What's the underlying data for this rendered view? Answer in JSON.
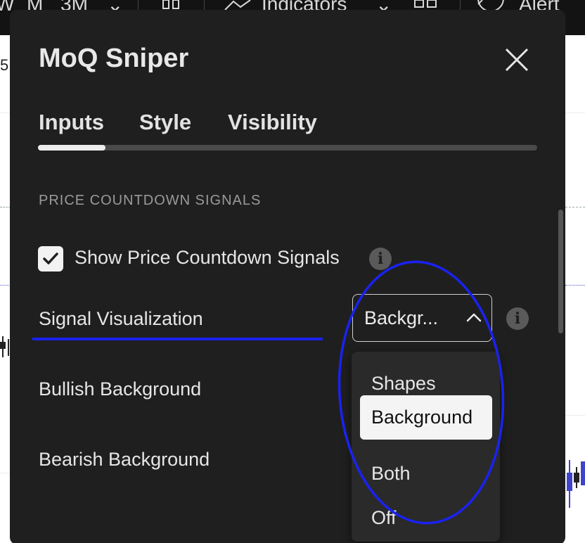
{
  "toolbar": {
    "items": [
      "W",
      "M",
      "3M",
      "⌄",
      "Indicators",
      "⌄",
      "Alert"
    ]
  },
  "chart": {
    "price_label": "5"
  },
  "dialog": {
    "title": "MoQ Sniper",
    "tabs": [
      "Inputs",
      "Style",
      "Visibility"
    ],
    "active_tab": "Inputs",
    "section_header": "PRICE COUNTDOWN SIGNALS",
    "show_signals": {
      "label": "Show Price Countdown Signals",
      "checked": true
    },
    "signal_visualization": {
      "label": "Signal Visualization",
      "value": "Backgr...",
      "options": [
        "Shapes",
        "Background",
        "Both",
        "Off"
      ],
      "selected": "Background"
    },
    "bullish_background": {
      "label": "Bullish Background"
    },
    "bearish_background": {
      "label": "Bearish Background"
    }
  },
  "colors": {
    "dialog_bg": "#1f1f1f",
    "accent_underline": "#1a22f0",
    "annotation_circle": "#1a22f0",
    "candle_blue": "#3d44c9"
  }
}
